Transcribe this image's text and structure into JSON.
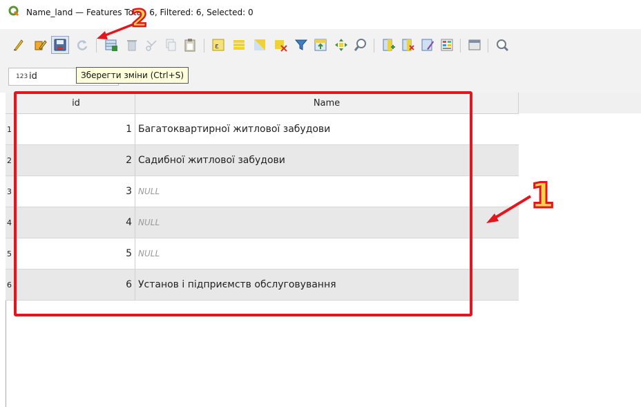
{
  "window": {
    "title": "Name_land — Features Total: 6, Filtered: 6, Selected: 0"
  },
  "toolbar": {
    "buttons": [
      {
        "icon": "pencil-icon",
        "name": "toggle-editing-button"
      },
      {
        "icon": "multi-edit-icon",
        "name": "multi-edit-button"
      },
      {
        "icon": "save-icon",
        "name": "save-edits-button"
      },
      {
        "icon": "reload-icon",
        "name": "reload-button"
      },
      {
        "icon": "add-feature-icon",
        "name": "add-feature-button"
      },
      {
        "icon": "delete-icon",
        "name": "delete-selected-button"
      },
      {
        "icon": "cut-icon",
        "name": "cut-button"
      },
      {
        "icon": "copy-icon",
        "name": "copy-button"
      },
      {
        "icon": "paste-icon",
        "name": "paste-button"
      },
      {
        "icon": "expression-select-icon",
        "name": "select-by-expression-button"
      },
      {
        "icon": "select-all-icon",
        "name": "select-all-button"
      },
      {
        "icon": "invert-selection-icon",
        "name": "invert-selection-button"
      },
      {
        "icon": "deselect-icon",
        "name": "deselect-all-button"
      },
      {
        "icon": "filter-icon",
        "name": "filter-button"
      },
      {
        "icon": "move-top-icon",
        "name": "move-selection-top-button"
      },
      {
        "icon": "pan-icon",
        "name": "pan-to-selection-button"
      },
      {
        "icon": "zoom-icon",
        "name": "zoom-to-selection-button"
      },
      {
        "icon": "new-field-icon",
        "name": "new-field-button"
      },
      {
        "icon": "delete-field-icon",
        "name": "delete-field-button"
      },
      {
        "icon": "field-calculator-icon",
        "name": "field-calculator-button"
      },
      {
        "icon": "conditional-format-icon",
        "name": "conditional-formatting-button"
      },
      {
        "icon": "dock-icon",
        "name": "dock-button"
      },
      {
        "icon": "actions-icon",
        "name": "actions-button"
      }
    ],
    "tooltip": "Зберегти зміни (Ctrl+S)"
  },
  "filter": {
    "field_type": "123",
    "field_name": "id"
  },
  "table": {
    "columns": [
      "id",
      "Name"
    ],
    "rows": [
      {
        "row": "1",
        "id": "1",
        "name": "Багатоквартирної житлової забудови",
        "is_null": false
      },
      {
        "row": "2",
        "id": "2",
        "name": "Садибної житлової забудови",
        "is_null": false
      },
      {
        "row": "3",
        "id": "3",
        "name": "NULL",
        "is_null": true
      },
      {
        "row": "4",
        "id": "4",
        "name": "NULL",
        "is_null": true
      },
      {
        "row": "5",
        "id": "5",
        "name": "NULL",
        "is_null": true
      },
      {
        "row": "6",
        "id": "6",
        "name": "Установ і підприємств обслуговування",
        "is_null": false
      }
    ]
  },
  "annotations": {
    "label_1": "1",
    "label_2": "2",
    "color": "#e4161d"
  }
}
